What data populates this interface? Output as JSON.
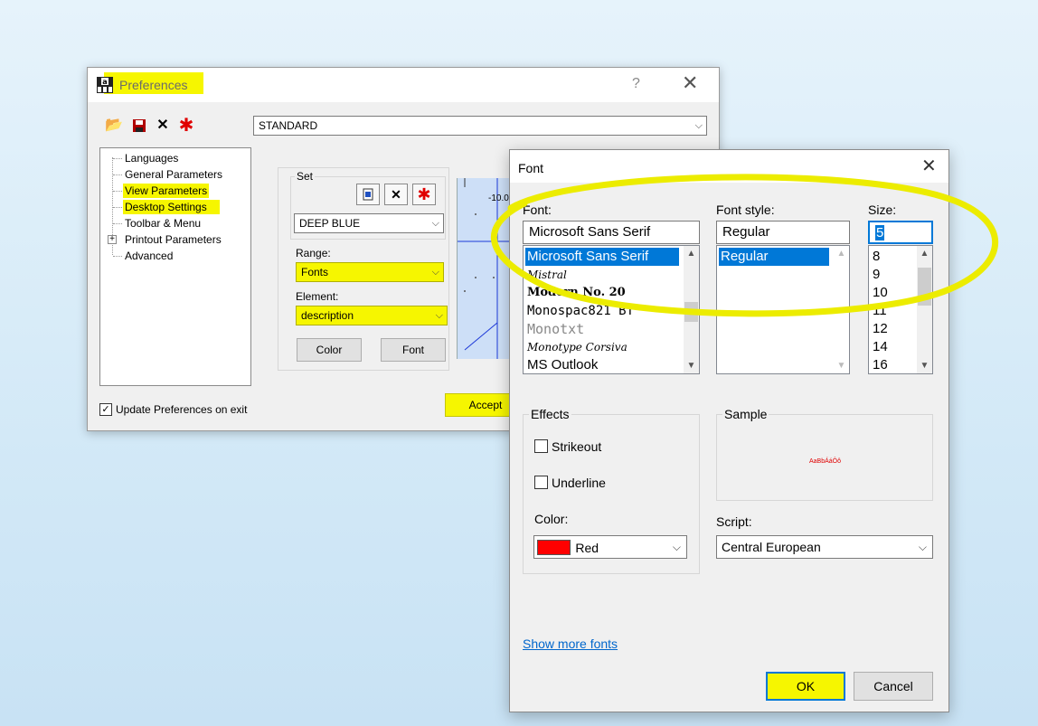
{
  "preferences": {
    "title": "Preferences",
    "help_label": "?",
    "close_label": "✕",
    "toolbar": {
      "open_icon": "📂",
      "save_icon": "💾",
      "delete_icon": "✕",
      "new_icon": "✱"
    },
    "profile_combo": "STANDARD",
    "tree": {
      "items": [
        {
          "label": "Languages"
        },
        {
          "label": "General Parameters"
        },
        {
          "label": "View Parameters"
        },
        {
          "label": "Desktop Settings"
        },
        {
          "label": "Toolbar & Menu"
        },
        {
          "label": "Printout Parameters",
          "expander": "+"
        },
        {
          "label": "Advanced"
        }
      ]
    },
    "set_group": {
      "label": "Set",
      "combo": "DEEP BLUE"
    },
    "range": {
      "label": "Range:",
      "value": "Fonts"
    },
    "element": {
      "label": "Element:",
      "value": "description"
    },
    "color_button": "Color",
    "font_button": "Font",
    "preview_tick": "-10.0",
    "update_checkbox": {
      "label": "Update Preferences on exit",
      "checked": true
    },
    "accept_button": "Accept"
  },
  "font_dialog": {
    "title": "Font",
    "close_label": "✕",
    "font": {
      "label": "Font:",
      "value": "Microsoft Sans Serif",
      "options": [
        "Microsoft Sans Serif",
        "Mistral",
        "Modern No. 20",
        "Monospac821 BT",
        "Monotxt",
        "Monotype Corsiva",
        "MS Outlook"
      ],
      "selected_index": 0
    },
    "style": {
      "label": "Font style:",
      "value": "Regular",
      "options": [
        "Regular"
      ],
      "selected_index": 0
    },
    "size": {
      "label": "Size:",
      "value": "5",
      "options": [
        "8",
        "9",
        "10",
        "11",
        "12",
        "14",
        "16"
      ]
    },
    "effects": {
      "label": "Effects",
      "strikeout": {
        "label": "Strikeout",
        "checked": false
      },
      "underline": {
        "label": "Underline",
        "checked": false
      },
      "color_label": "Color:",
      "color_value": "Red",
      "color_swatch": "#ff0000"
    },
    "sample": {
      "label": "Sample",
      "text": "AaBbÁáÔô"
    },
    "script": {
      "label": "Script:",
      "value": "Central European"
    },
    "show_more_link": "Show more fonts",
    "ok_button": "OK",
    "cancel_button": "Cancel"
  },
  "colors": {
    "highlight": "#f6f600",
    "selection": "#0078d7",
    "link": "#0066cc"
  }
}
